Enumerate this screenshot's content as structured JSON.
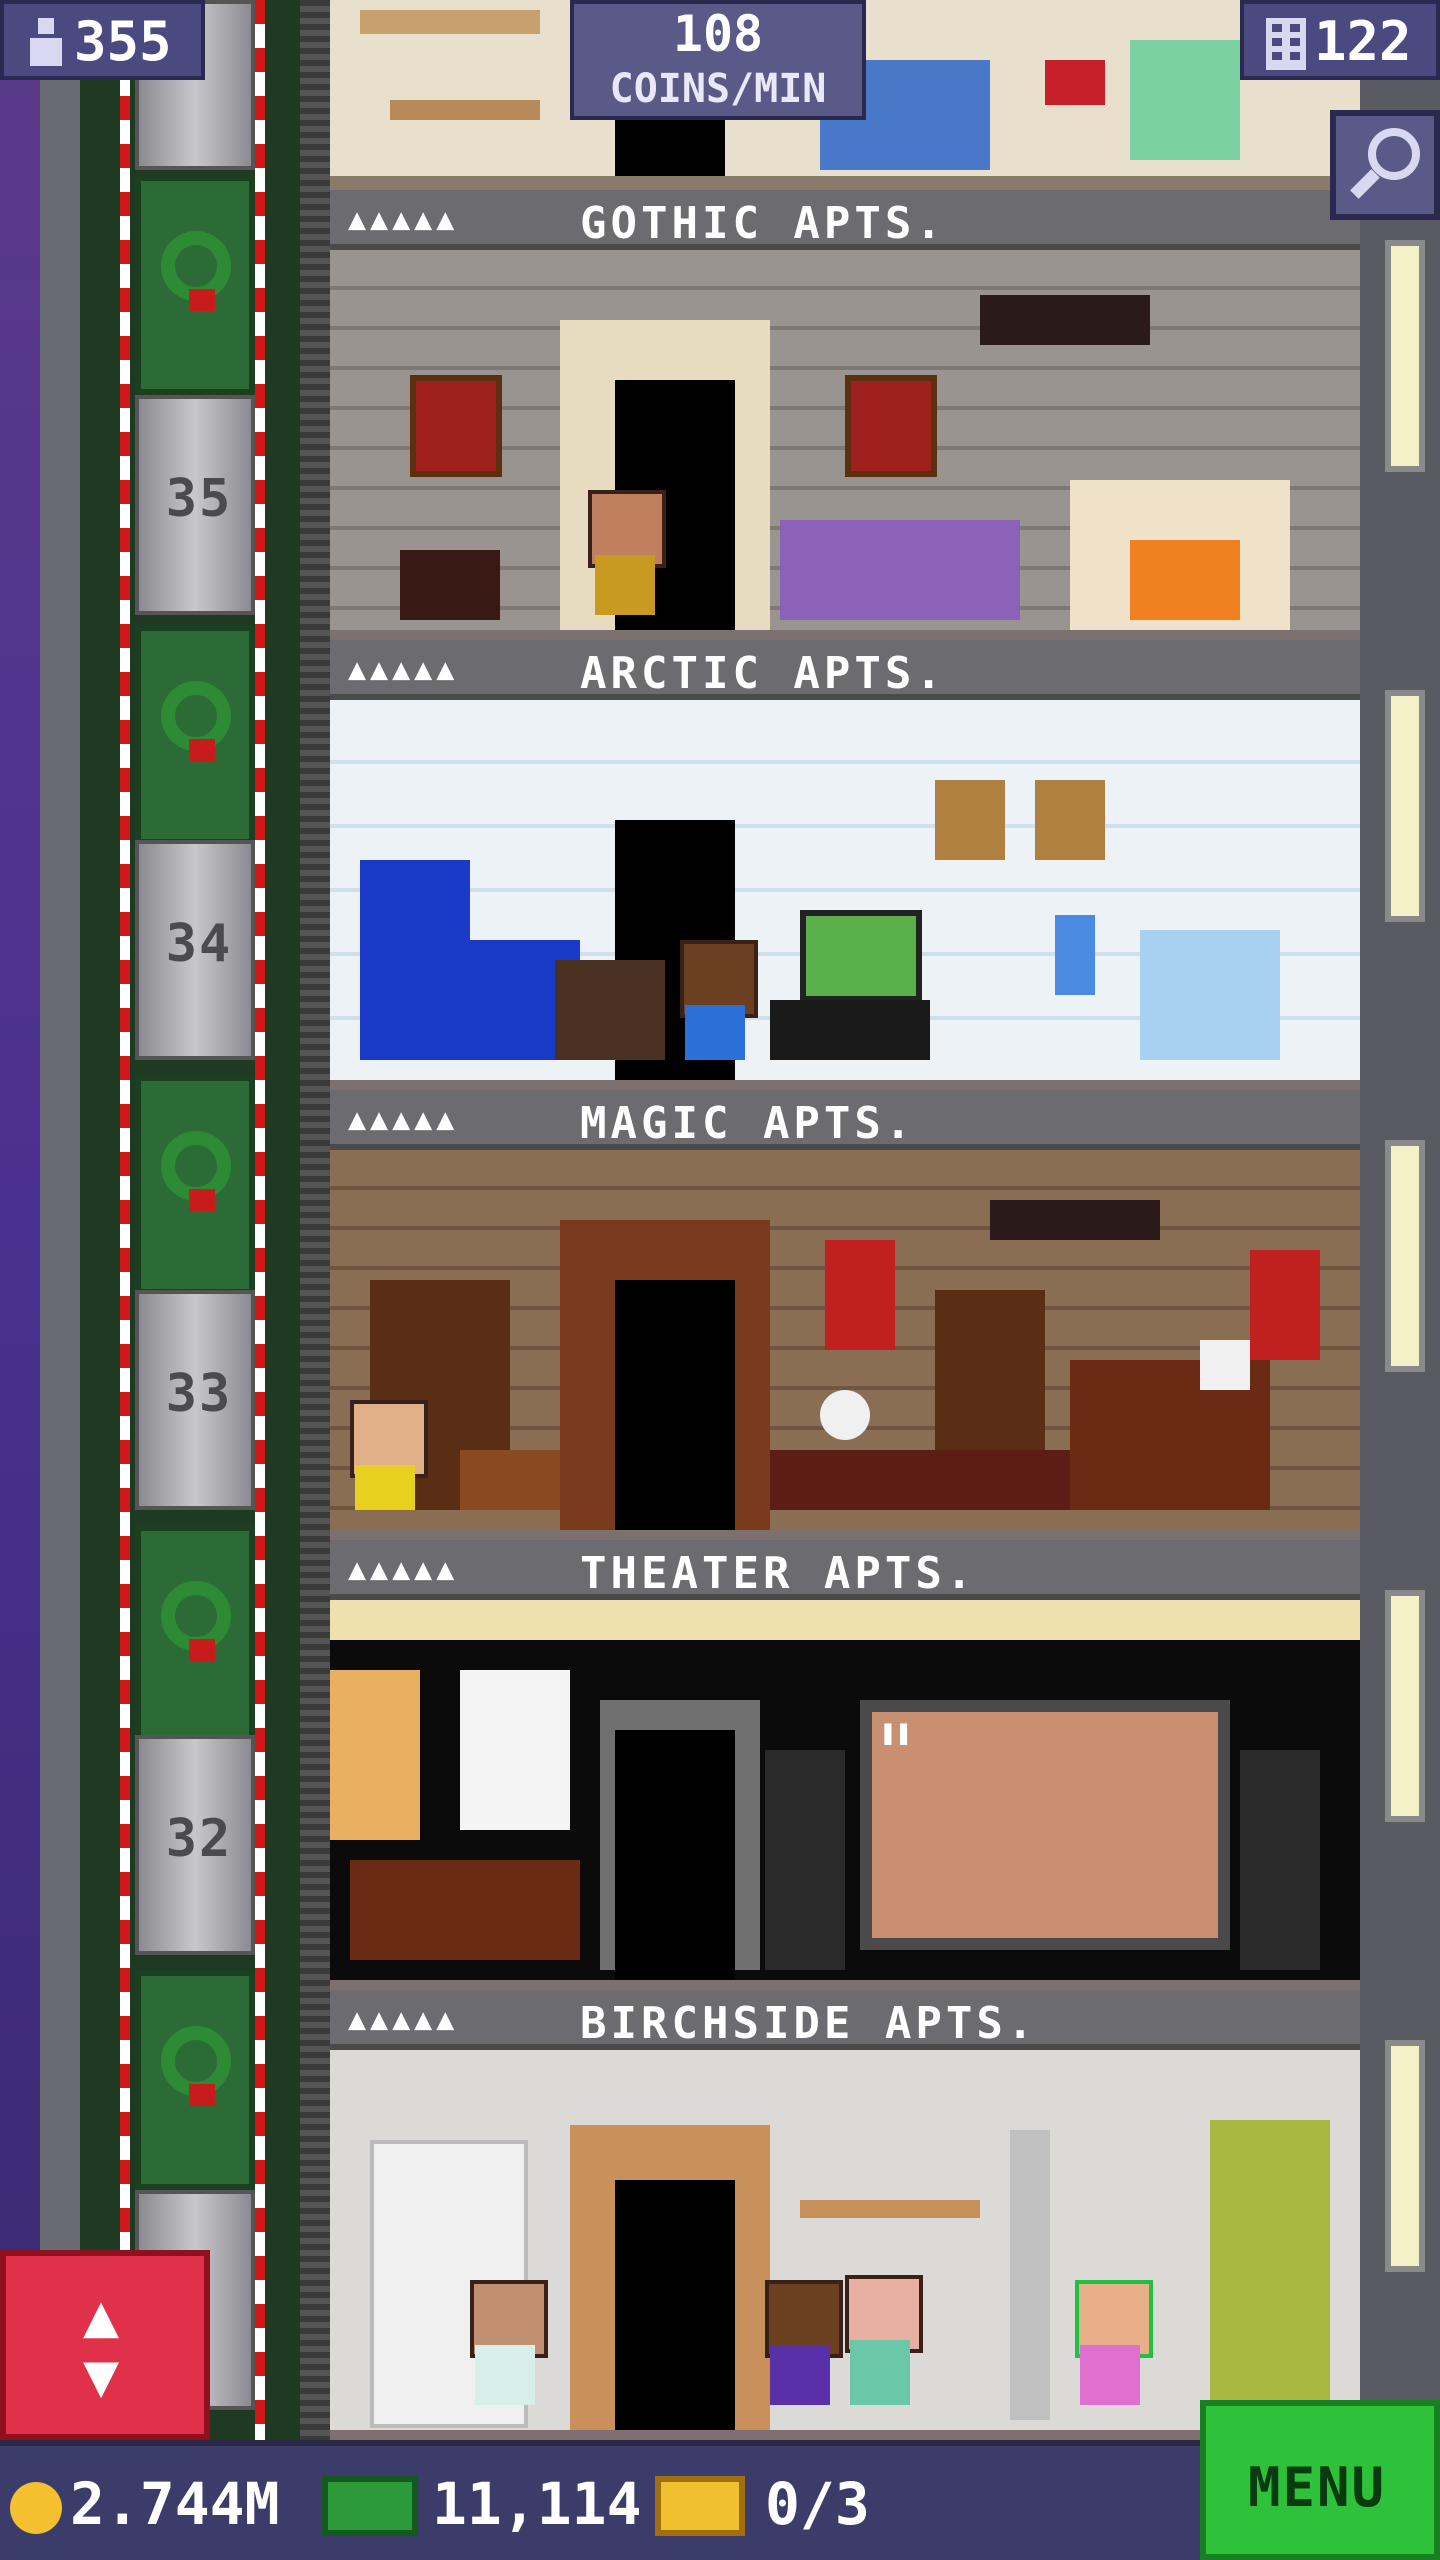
{
  "hud": {
    "population": "355",
    "coins_per_min_value": "108",
    "coins_per_min_label": "COINS/MIN",
    "floor_count": "122"
  },
  "elevator": {
    "floor_labels": [
      "35",
      "34",
      "33",
      "32"
    ]
  },
  "floors": [
    {
      "name": "GOTHIC APTS.",
      "stars": "▲▲▲▲▲"
    },
    {
      "name": "ARCTIC APTS.",
      "stars": "▲▲▲▲▲"
    },
    {
      "name": "MAGIC APTS.",
      "stars": "▲▲▲▲▲"
    },
    {
      "name": "THEATER APTS.",
      "stars": "▲▲▲▲▲"
    },
    {
      "name": "BIRCHSIDE APTS.",
      "stars": "▲▲▲▲▲"
    }
  ],
  "bottom_bar": {
    "coins": "2.744M",
    "bux": "11,114",
    "tickets": "0/3",
    "menu_label": "MENU"
  },
  "colors": {
    "menu_green": "#2ec23a",
    "elevator_button_red": "#e0304a",
    "hud_purple": "#4a4a80"
  }
}
